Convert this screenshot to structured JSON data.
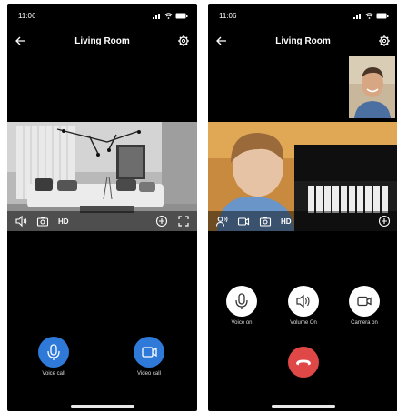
{
  "status_bar": {
    "time": "11:06"
  },
  "header": {
    "title": "Living Room"
  },
  "left": {
    "toolbar": {
      "hd_label": "HD"
    },
    "actions": [
      {
        "label": "Voice call",
        "color": "#2f7ad9"
      },
      {
        "label": "Video call",
        "color": "#2f7ad9"
      }
    ]
  },
  "right": {
    "toolbar": {
      "hd_label": "HD"
    },
    "controls": [
      {
        "label": "Voice on"
      },
      {
        "label": "Volume On"
      },
      {
        "label": "Camera on"
      }
    ],
    "hangup_color": "#e04848"
  }
}
